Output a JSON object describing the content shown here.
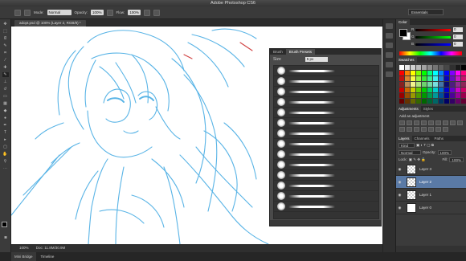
{
  "app": {
    "title": "Adobe Photoshop CS6"
  },
  "options": {
    "mode_label": "Mode:",
    "mode_value": "Normal",
    "opacity_label": "Opacity:",
    "opacity_value": "100%",
    "flow_label": "Flow:",
    "flow_value": "100%",
    "workspace": "Essentials"
  },
  "document": {
    "tab": "adopt.psd @ 100% (Layer 2, RGB/8) *"
  },
  "status": {
    "zoom": "100%",
    "doc_size": "Doc: 11.8M/30.9M"
  },
  "bottom_tabs": [
    "Mini Bridge",
    "Timeline"
  ],
  "brush_panel": {
    "tabs": [
      "Brush",
      "Brush Presets"
    ],
    "size_label": "Size",
    "size_value": "5 px"
  },
  "color_panel": {
    "tabs": [
      "Color"
    ],
    "r_label": "R",
    "g_label": "G",
    "b_label": "B",
    "r": "0",
    "g": "0",
    "b": "0"
  },
  "swatches_panel": {
    "tabs": [
      "Swatches"
    ]
  },
  "adjustments_panel": {
    "tabs": [
      "Adjustments",
      "Styles"
    ],
    "title": "Add an adjustment"
  },
  "layers_panel": {
    "tabs": [
      "Layers",
      "Channels",
      "Paths"
    ],
    "kind": "Kind",
    "blend": "Normal",
    "opacity_label": "Opacity:",
    "opacity": "100%",
    "lock_label": "Lock:",
    "fill_label": "Fill:",
    "fill": "100%",
    "layers": [
      "Layer 3",
      "Layer 2",
      "Layer 1",
      "Layer 0"
    ]
  },
  "colors": {
    "sketch": "#59b4e6",
    "selected_layer": "#5a7aa6",
    "panel": "#3b3b3b"
  }
}
